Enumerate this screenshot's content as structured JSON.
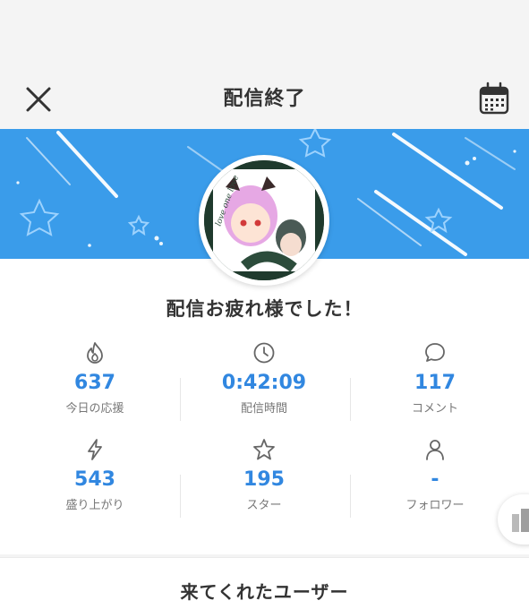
{
  "header": {
    "title": "配信終了",
    "close_icon": "close-icon",
    "calendar_icon": "calendar-icon"
  },
  "banner": {
    "color": "#3a9cea",
    "avatar_text": "love one love"
  },
  "message": "配信お疲れ様でした！",
  "stats": [
    {
      "icon": "flame-icon",
      "value": "637",
      "label": "今日の応援"
    },
    {
      "icon": "clock-icon",
      "value": "0:42:09",
      "label": "配信時間"
    },
    {
      "icon": "comment-icon",
      "value": "117",
      "label": "コメント"
    },
    {
      "icon": "lightning-icon",
      "value": "543",
      "label": "盛り上がり"
    },
    {
      "icon": "star-icon",
      "value": "195",
      "label": "スター"
    },
    {
      "icon": "user-icon",
      "value": "-",
      "label": "フォロワー"
    }
  ],
  "accent_color": "#3187e0",
  "users_section": {
    "title": "来てくれたユーザー"
  }
}
